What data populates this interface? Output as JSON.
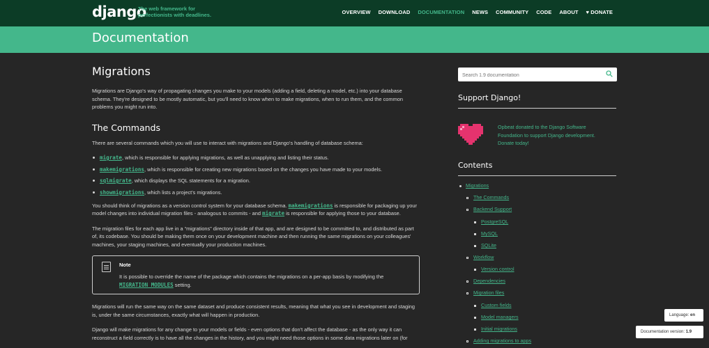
{
  "header": {
    "logo": "django",
    "tagline": "The web framework for perfectionists with deadlines.",
    "nav": [
      "OVERVIEW",
      "DOWNLOAD",
      "DOCUMENTATION",
      "NEWS",
      "COMMUNITY",
      "CODE",
      "ABOUT",
      "DONATE"
    ],
    "active_nav": "DOCUMENTATION",
    "donate_icon": "heart-icon"
  },
  "banner": {
    "title": "Documentation"
  },
  "main": {
    "title": "Migrations",
    "intro": "Migrations are Django's way of propagating changes you make to your models (adding a field, deleting a model, etc.) into your database schema. They're designed to be mostly automatic, but you'll need to know when to make migrations, when to run them, and the common problems you might run into.",
    "commands_heading": "The Commands",
    "commands_intro": "There are several commands which you will use to interact with migrations and Django's handling of database schema:",
    "commands": [
      {
        "code": "migrate",
        "text": ", which is responsible for applying migrations, as well as unapplying and listing their status."
      },
      {
        "code": "makemigrations",
        "text": ", which is responsible for creating new migrations based on the changes you have made to your models."
      },
      {
        "code": "sqlmigrate",
        "text": ", which displays the SQL statements for a migration."
      },
      {
        "code": "showmigrations",
        "text": ", which lists a project's migrations."
      }
    ],
    "para2": {
      "a": "You should think of migrations as a version control system for your database schema. ",
      "code1": "makemigrations",
      "b": " is responsible for packaging up your model changes into individual migration files - analogous to commits - and ",
      "code2": "migrate",
      "c": " is responsible for applying those to your database."
    },
    "para3": "The migration files for each app live in a “migrations” directory inside of that app, and are designed to be committed to, and distributed as part of, its codebase. You should be making them once on your development machine and then running the same migrations on your colleagues' machines, your staging machines, and eventually your production machines.",
    "note": {
      "title": "Note",
      "text": "It is possible to override the name of the package which contains the migrations on a per-app basis by modifying the ",
      "code": "MIGRATION_MODULES",
      "text_end": " setting."
    },
    "para4": "Migrations will run the same way on the same dataset and produce consistent results, meaning that what you see in development and staging is, under the same circumstances, exactly what will happen in production.",
    "para5": "Django will make migrations for any change to your models or fields - even options that don't affect the database - as the only way it can reconstruct a field correctly is to have all the changes in the history, and you might need those options in some data migrations later on (for"
  },
  "sidebar": {
    "search_placeholder": "Search 1.9 documentation",
    "support_heading": "Support Django!",
    "support_text": "Opbeat donated to the Django Software Foundation to support Django development. Donate today!",
    "contents_heading": "Contents",
    "toc": [
      "Migrations",
      "The Commands",
      "Backend Support",
      "PostgreSQL",
      "MySQL",
      "SQLite",
      "Workflow",
      "Version control",
      "Dependencies",
      "Migration files",
      "Custom fields",
      "Model managers",
      "Initial migrations",
      "Adding migrations to apps"
    ]
  },
  "footer_badges": {
    "language_label": "Language:",
    "language_value": "en",
    "version_label": "Documentation version:",
    "version_value": "1.9"
  },
  "colors": {
    "dark_green": "#0c3c26",
    "accent_green": "#44b78b",
    "background": "#262626",
    "heart": "#e5336e"
  }
}
